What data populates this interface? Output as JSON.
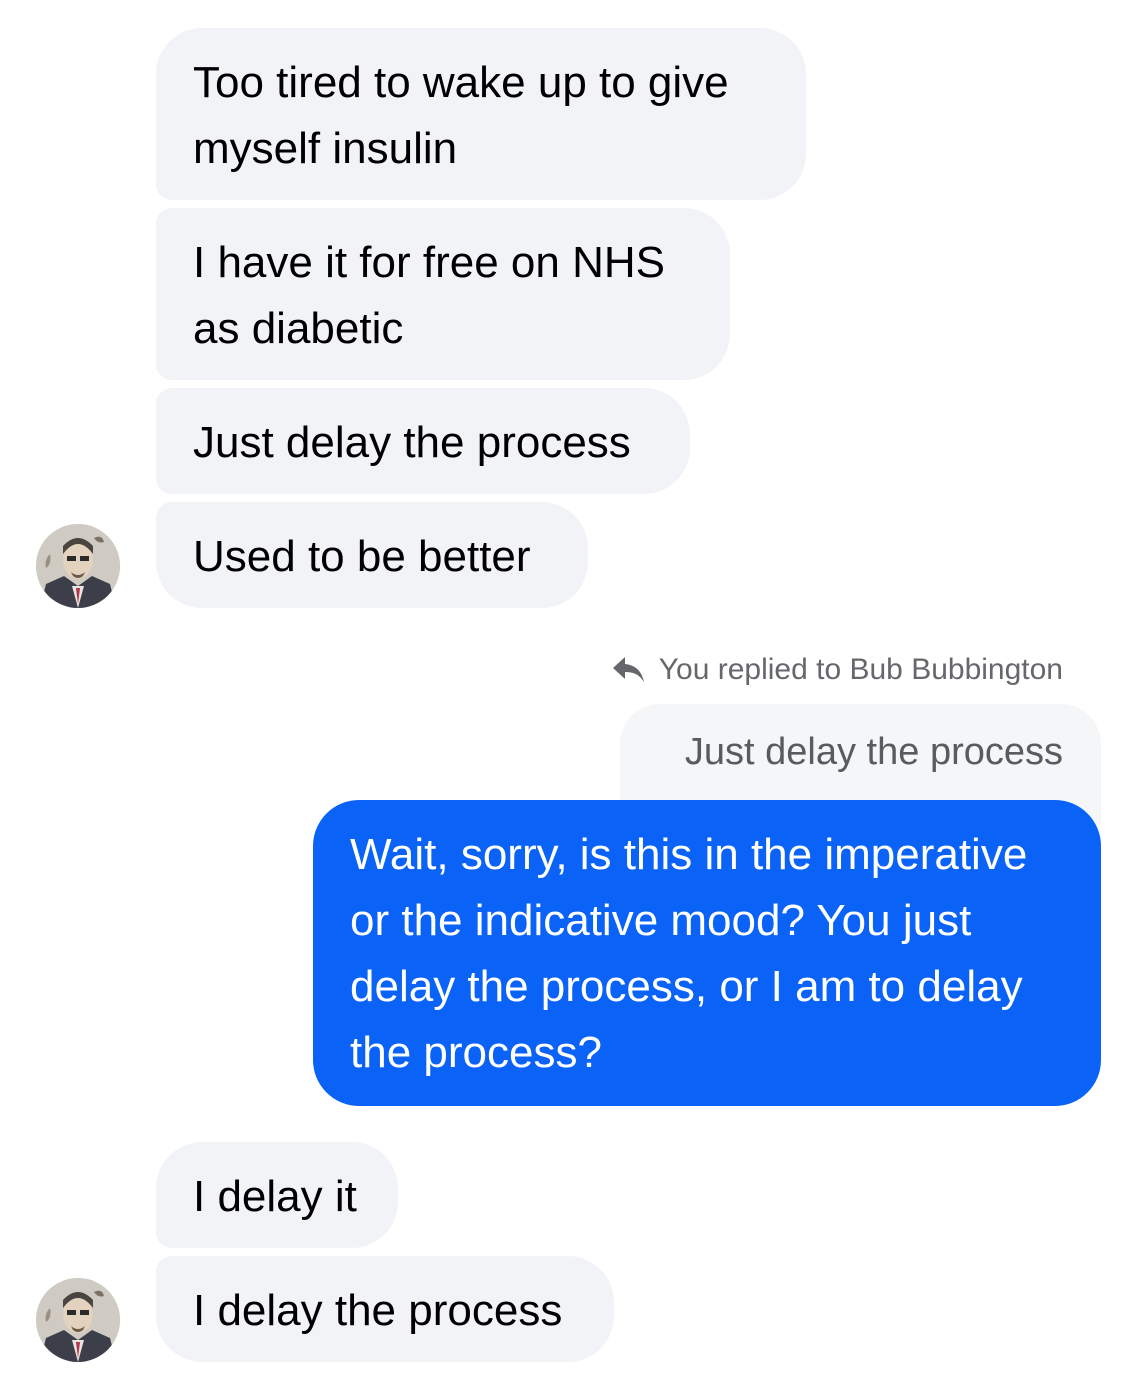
{
  "colors": {
    "incoming_bubble": "#f2f3f7",
    "outgoing_bubble": "#0a63f6",
    "meta_text": "#65676b"
  },
  "messages_group_1": [
    {
      "text": "Too tired to wake up to give\nmyself insulin"
    },
    {
      "text": "I have it for free on NHS\nas diabetic"
    },
    {
      "text": "Just delay the process"
    },
    {
      "text": "Used to be better"
    }
  ],
  "reply": {
    "icon": "reply-arrow-icon",
    "label": "You replied to Bub Bubbington",
    "quoted_text": "Just delay the process"
  },
  "outgoing_message": {
    "text": "Wait, sorry, is this in the imperative or the indicative mood? You just delay the process, or I am to delay the process?"
  },
  "messages_group_2": [
    {
      "text": "I delay it"
    },
    {
      "text": "I delay the process"
    }
  ],
  "avatar": {
    "icon": "contact-avatar"
  }
}
